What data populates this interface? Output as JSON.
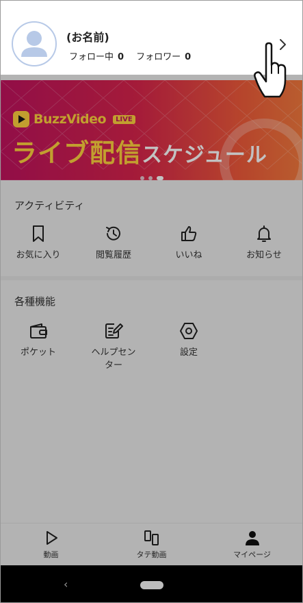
{
  "profile": {
    "name": "(お名前)",
    "following_label": "フォロー中",
    "following_count": "0",
    "followers_label": "フォロワー",
    "followers_count": "0"
  },
  "banner": {
    "brand": "BuzzVideo",
    "badge": "LIVE",
    "headline_main": "ライブ配信",
    "headline_sub": "スケジュール",
    "page_count": 3,
    "active_page": 3
  },
  "activity": {
    "title": "アクティビティ",
    "items": [
      {
        "label": "お気に入り",
        "icon": "bookmark-icon"
      },
      {
        "label": "閲覧履歴",
        "icon": "history-icon"
      },
      {
        "label": "いいね",
        "icon": "thumbs-up-icon"
      },
      {
        "label": "お知らせ",
        "icon": "bell-icon"
      }
    ]
  },
  "features": {
    "title": "各種機能",
    "items": [
      {
        "label": "ポケット",
        "icon": "wallet-icon"
      },
      {
        "label": "ヘルプセン\nター",
        "icon": "edit-note-icon"
      },
      {
        "label": "設定",
        "icon": "settings-hexagon-icon"
      }
    ]
  },
  "tabbar": {
    "items": [
      {
        "label": "動画",
        "icon": "play-icon"
      },
      {
        "label": "タテ動画",
        "icon": "vertical-video-icon"
      },
      {
        "label": "マイページ",
        "icon": "person-icon",
        "active": true
      }
    ]
  },
  "colors": {
    "banner_start": "#c0135e",
    "banner_end": "#f37a3d",
    "banner_text": "#ffd23f",
    "avatar_border": "#b7c9e7"
  }
}
